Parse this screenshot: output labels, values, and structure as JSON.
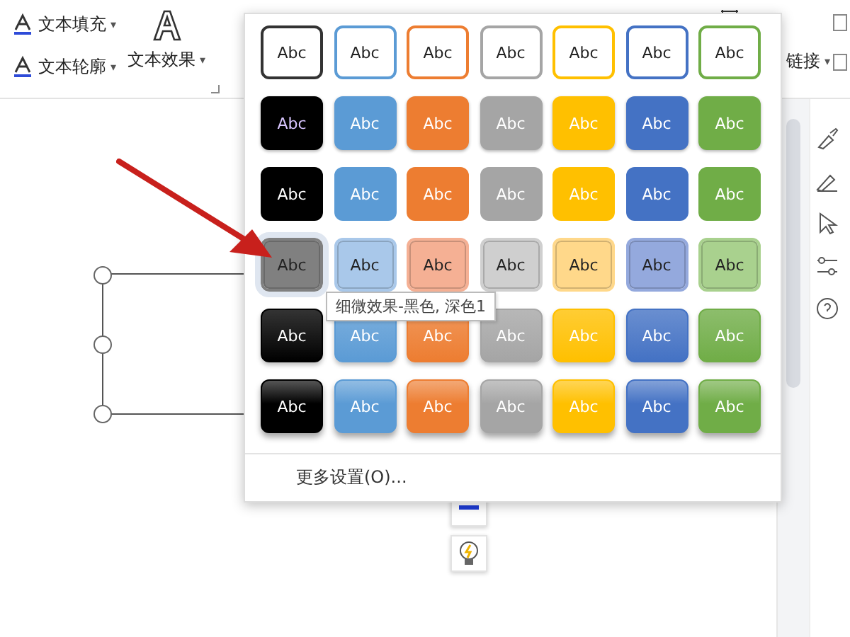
{
  "ribbon": {
    "groups": [
      {
        "kind": "fill",
        "label": "文本填充",
        "caret": "▾"
      },
      {
        "kind": "outline",
        "label": "文本轮廓",
        "caret": "▾"
      },
      {
        "kind": "effect",
        "label": "文本效果",
        "caret": "▾"
      }
    ],
    "link": {
      "label": "链接",
      "caret": "▾"
    }
  },
  "gallery": {
    "rows": [
      {
        "kind": "outline",
        "swatches": [
          {
            "label": "Abc",
            "color": "#333333",
            "selected": false
          },
          {
            "label": "Abc",
            "color": "#5b9bd5",
            "selected": false
          },
          {
            "label": "Abc",
            "color": "#ed7d31",
            "selected": false
          },
          {
            "label": "Abc",
            "color": "#a5a5a5",
            "selected": false
          },
          {
            "label": "Abc",
            "color": "#ffc000",
            "selected": false
          },
          {
            "label": "Abc",
            "color": "#4472c4",
            "selected": false
          },
          {
            "label": "Abc",
            "color": "#70ad47",
            "selected": false
          }
        ]
      },
      {
        "kind": "solid",
        "swatches": [
          {
            "label": "Abc",
            "color": "#000000",
            "selected": false
          },
          {
            "label": "Abc",
            "color": "#5b9bd5",
            "selected": false
          },
          {
            "label": "Abc",
            "color": "#ed7d31",
            "selected": false
          },
          {
            "label": "Abc",
            "color": "#a5a5a5",
            "selected": false
          },
          {
            "label": "Abc",
            "color": "#ffc000",
            "selected": false
          },
          {
            "label": "Abc",
            "color": "#4472c4",
            "selected": false
          },
          {
            "label": "Abc",
            "color": "#70ad47",
            "selected": false
          }
        ]
      },
      {
        "kind": "flat",
        "swatches": [
          {
            "label": "Abc",
            "color": "#000000",
            "selected": false
          },
          {
            "label": "Abc",
            "color": "#5b9bd5",
            "selected": false
          },
          {
            "label": "Abc",
            "color": "#ed7d31",
            "selected": false
          },
          {
            "label": "Abc",
            "color": "#a5a5a5",
            "selected": false
          },
          {
            "label": "Abc",
            "color": "#ffc000",
            "selected": false
          },
          {
            "label": "Abc",
            "color": "#4472c4",
            "selected": false
          },
          {
            "label": "Abc",
            "color": "#70ad47",
            "selected": false
          }
        ]
      },
      {
        "kind": "subtle",
        "swatches": [
          {
            "label": "Abc",
            "color": "#808080",
            "selected": true
          },
          {
            "label": "Abc",
            "color": "#a9c8ea",
            "selected": false
          },
          {
            "label": "Abc",
            "color": "#f5b094",
            "selected": false
          },
          {
            "label": "Abc",
            "color": "#cfcfcf",
            "selected": false
          },
          {
            "label": "Abc",
            "color": "#ffd88a",
            "selected": false
          },
          {
            "label": "Abc",
            "color": "#94a9dd",
            "selected": false
          },
          {
            "label": "Abc",
            "color": "#a9d18e",
            "selected": false
          }
        ]
      },
      {
        "kind": "gradient",
        "swatches": [
          {
            "label": "Abc",
            "color": "#000000",
            "selected": false
          },
          {
            "label": "Abc",
            "color": "#5b9bd5",
            "selected": false
          },
          {
            "label": "Abc",
            "color": "#ed7d31",
            "selected": false
          },
          {
            "label": "Abc",
            "color": "#a5a5a5",
            "selected": false
          },
          {
            "label": "Abc",
            "color": "#ffc000",
            "selected": false
          },
          {
            "label": "Abc",
            "color": "#4472c4",
            "selected": false
          },
          {
            "label": "Abc",
            "color": "#70ad47",
            "selected": false
          }
        ]
      },
      {
        "kind": "intense",
        "swatches": [
          {
            "label": "Abc",
            "color": "#000000",
            "selected": false
          },
          {
            "label": "Abc",
            "color": "#5b9bd5",
            "selected": false
          },
          {
            "label": "Abc",
            "color": "#ed7d31",
            "selected": false
          },
          {
            "label": "Abc",
            "color": "#a5a5a5",
            "selected": false
          },
          {
            "label": "Abc",
            "color": "#ffc000",
            "selected": false
          },
          {
            "label": "Abc",
            "color": "#4472c4",
            "selected": false
          },
          {
            "label": "Abc",
            "color": "#70ad47",
            "selected": false
          }
        ]
      }
    ],
    "more": "更多设置(O)...",
    "tooltip": "细微效果-黑色, 深色1"
  }
}
